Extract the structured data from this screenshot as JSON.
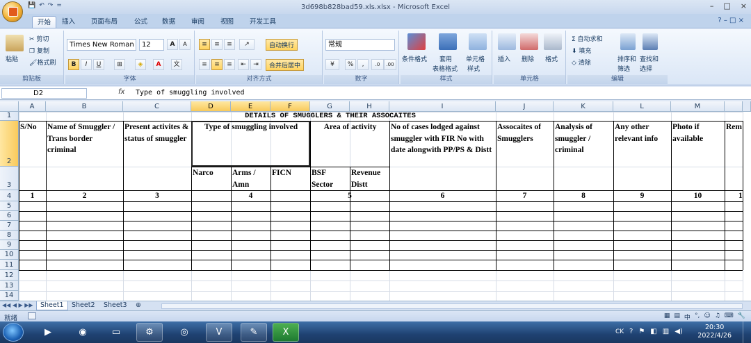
{
  "window": {
    "title": "3d698b828bad59.xls.xlsx - Microsoft Excel",
    "controls": [
      "–",
      "□",
      "×"
    ]
  },
  "qat": {
    "save": "💾",
    "undo": "↶",
    "redo": "↷",
    "more": "="
  },
  "tabs": [
    "开始",
    "插入",
    "页面布局",
    "公式",
    "数据",
    "审阅",
    "视图",
    "开发工具"
  ],
  "active_tab": "开始",
  "ribbon": {
    "clipboard": {
      "paste": "粘贴",
      "cut": "剪切",
      "copy": "复制",
      "format_painter": "格式刷",
      "label": "剪贴板"
    },
    "font": {
      "name": "Times New Roman",
      "size": "12",
      "grow": "A",
      "shrink": "A",
      "bold": "B",
      "italic": "I",
      "underline": "U",
      "border": "⊞",
      "fill": "◈",
      "color": "A",
      "phonetic": "文",
      "label": "字体"
    },
    "alignment": {
      "wrap": "自动换行",
      "merge": "合并后居中",
      "label": "对齐方式"
    },
    "number": {
      "format": "常规",
      "currency": "¥",
      "percent": "%",
      "comma": ",",
      "inc": ".0",
      "dec": ".00",
      "label": "数字"
    },
    "styles": {
      "conditional": "条件格式",
      "table": "套用",
      "table2": "表格格式",
      "cell": "单元格",
      "cell2": "样式",
      "label": "样式"
    },
    "cells": {
      "insert": "插入",
      "delete": "删除",
      "format": "格式",
      "label": "单元格"
    },
    "editing": {
      "autosum": "Σ 自动求和",
      "fill": "填充",
      "clear": "清除",
      "sort": "排序和",
      "sort2": "筛选",
      "find": "查找和",
      "find2": "选择",
      "label": "编辑"
    }
  },
  "formula_bar": {
    "name_box": "D2",
    "fx": "fx",
    "content": "Type of smuggling involved"
  },
  "columns": [
    "A",
    "B",
    "C",
    "D",
    "E",
    "F",
    "G",
    "H",
    "I",
    "J",
    "K",
    "L",
    "M"
  ],
  "rows": [
    "1",
    "2",
    "3",
    "4",
    "5",
    "6",
    "7",
    "8",
    "9",
    "10",
    "11",
    "12",
    "13",
    "14"
  ],
  "sheet": {
    "title": "DETAILS OF SMUGGLERS & THEIR ASSOCAITES",
    "h_sno": "S/No",
    "h_name": "Name of Smuggler / Trans border criminal",
    "h_present": "Present activites & status of smuggler",
    "h_type": "Type of smuggling involved",
    "h_area": "Area of activity",
    "h_cases": "No of cases lodged against smuggler with FIR No with date alongwith PP/PS & Distt",
    "h_assoc": "Assocaites of Smugglers",
    "h_analysis": "Analysis of smuggler / criminal",
    "h_other": "Any other relevant info",
    "h_photo": "Photo if available",
    "h_rem": "Rem",
    "sub_narco": "Narco",
    "sub_arms": "Arms / Amn",
    "sub_ficn": "FICN",
    "sub_bsf": "BSF Sector",
    "sub_revenue": "Revenue Distt",
    "nums": [
      "1",
      "2",
      "3",
      "4",
      "5",
      "6",
      "7",
      "8",
      "9",
      "10",
      "1"
    ],
    "data_rows": [
      "5",
      "6",
      "7",
      "8",
      "9",
      "10",
      "11"
    ]
  },
  "sheet_tabs": [
    "Sheet1",
    "Sheet2",
    "Sheet3"
  ],
  "status": {
    "mode": "就绪"
  },
  "taskbar": {
    "time": "20:30",
    "date": "2022/4/26",
    "lang": "CK",
    "ime": "中"
  }
}
